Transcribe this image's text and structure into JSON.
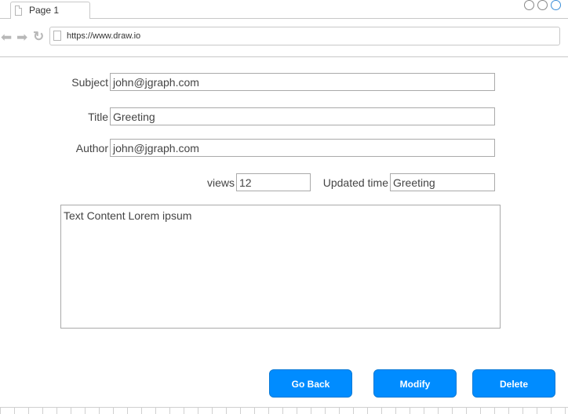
{
  "browser": {
    "tab_label": "Page 1",
    "url": "https://www.draw.io"
  },
  "form": {
    "subject": {
      "label": "Subject",
      "value": "john@jgraph.com"
    },
    "title": {
      "label": "Title",
      "value": "Greeting"
    },
    "author": {
      "label": "Author",
      "value": "john@jgraph.com"
    },
    "views": {
      "label": "views",
      "value": "12"
    },
    "updated_time": {
      "label": "Updated time",
      "value": "Greeting"
    },
    "content": "Text Content Lorem ipsum"
  },
  "actions": {
    "go_back": "Go Back",
    "modify": "Modify",
    "delete": "Delete"
  },
  "colors": {
    "button": "#008cff",
    "button_text": "#ffffff",
    "border": "#aaaaaa"
  },
  "icons": [
    "page-icon",
    "back-arrow-icon",
    "forward-arrow-icon",
    "reload-icon",
    "window-control-icon"
  ]
}
